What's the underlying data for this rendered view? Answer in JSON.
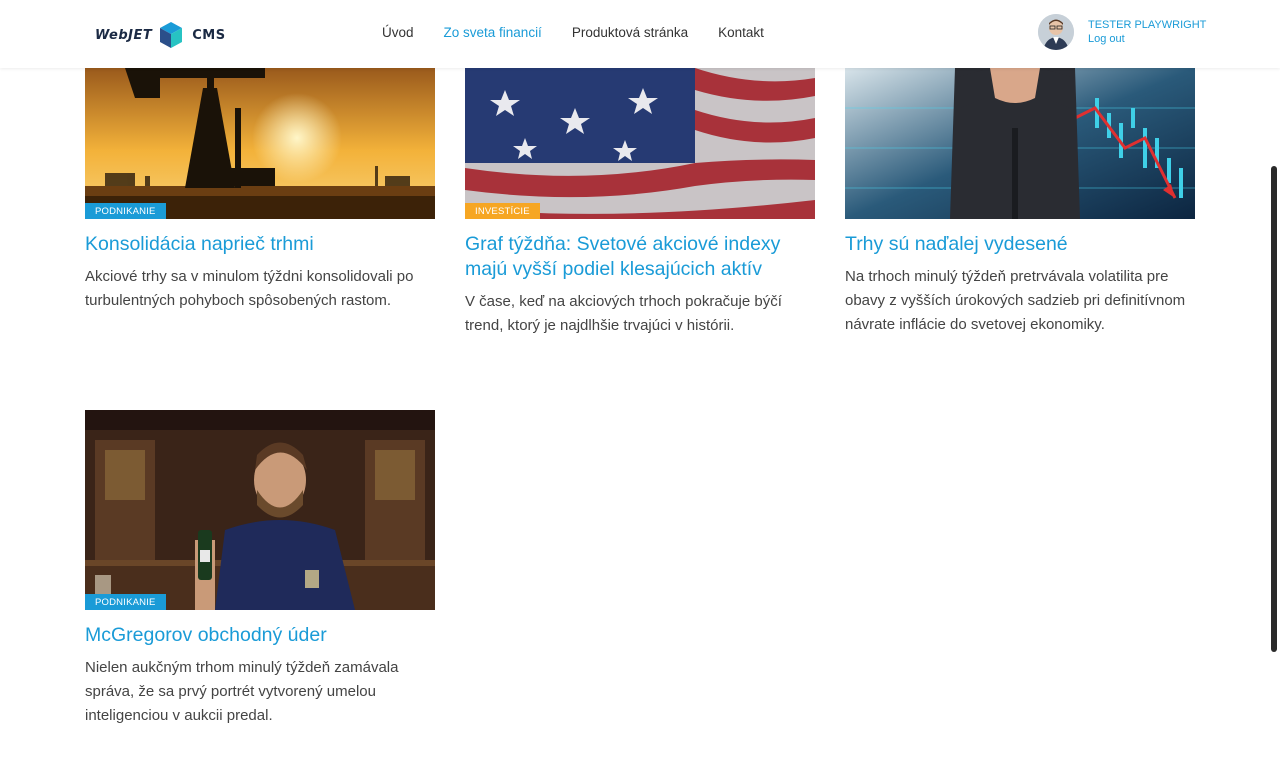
{
  "header": {
    "logo_left": "WebJET",
    "logo_right": "CMS",
    "nav": [
      {
        "label": "Úvod",
        "active": false
      },
      {
        "label": "Zo sveta financií",
        "active": true
      },
      {
        "label": "Produktová stránka",
        "active": false
      },
      {
        "label": "Kontakt",
        "active": false
      }
    ],
    "user_name": "TESTER PLAYWRIGHT",
    "logout_label": "Log out"
  },
  "articles": [
    {
      "category": "PODNIKANIE",
      "title": "Konsolidácia naprieč trhmi",
      "text": "Akciové trhy sa v minulom týždni konsolidovali po turbulentných pohyboch spôsobených rastom."
    },
    {
      "category": "INVESTÍCIE",
      "title": "Graf týždňa: Svetové akciové indexy majú vyšší podiel klesajúcich aktív",
      "text": "V čase, keď na akciových trhoch pokračuje býčí trend, ktorý je najdlhšie trvajúci v histórii."
    },
    {
      "category": "",
      "title": "Trhy sú naďalej vydesené",
      "text": "Na trhoch minulý týždeň pretrvávala volatilita pre obavy z vyšších úrokových sadzieb pri definitívnom návrate inflácie do svetovej ekonomiky."
    },
    {
      "category": "PODNIKANIE",
      "title": "McGregorov obchodný úder",
      "text": "Nielen aukčným trhom minulý týždeň zamávala správa, že sa prvý portrét vytvorený umelou inteligenciou v aukcii predal."
    }
  ],
  "colors": {
    "accent": "#1a9bd7",
    "badge_investicie": "#f6a623"
  }
}
